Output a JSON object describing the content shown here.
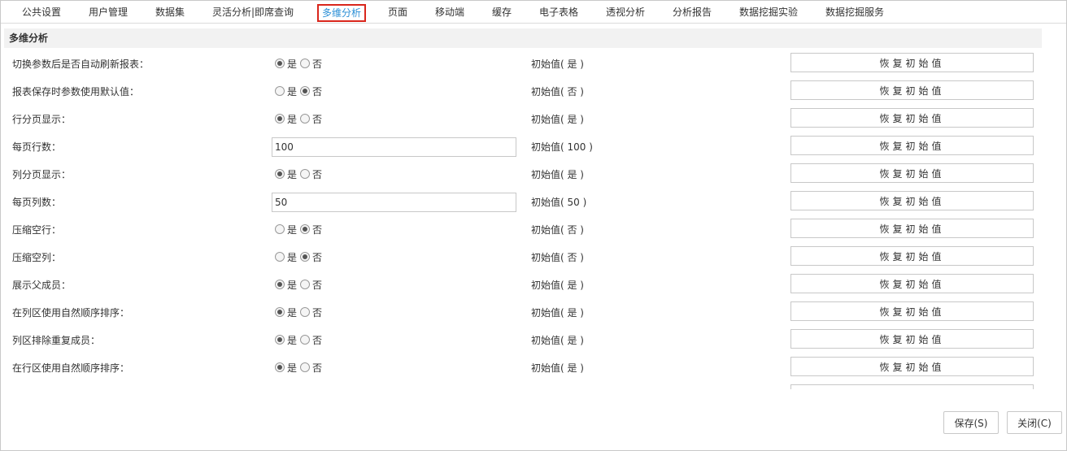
{
  "tabs": [
    {
      "label": "公共设置"
    },
    {
      "label": "用户管理"
    },
    {
      "label": "数据集"
    },
    {
      "label": "灵活分析|即席查询"
    },
    {
      "label": "多维分析",
      "active": true
    },
    {
      "label": "页面"
    },
    {
      "label": "移动端"
    },
    {
      "label": "缓存"
    },
    {
      "label": "电子表格"
    },
    {
      "label": "透视分析"
    },
    {
      "label": "分析报告"
    },
    {
      "label": "数据挖掘实验"
    },
    {
      "label": "数据挖掘服务"
    }
  ],
  "section_title": "多维分析",
  "radio_labels": {
    "yes": "是",
    "no": "否"
  },
  "reset_label": "恢复初始值",
  "rows": [
    {
      "label": "切换参数后是否自动刷新报表：",
      "type": "radio",
      "value": "yes",
      "initial": "初始值( 是 )"
    },
    {
      "label": "报表保存时参数使用默认值：",
      "type": "radio",
      "value": "no",
      "initial": "初始值( 否 )"
    },
    {
      "label": "行分页显示：",
      "type": "radio",
      "value": "yes",
      "initial": "初始值( 是 )"
    },
    {
      "label": "每页行数：",
      "type": "input",
      "value": "100",
      "initial": "初始值( 100 )"
    },
    {
      "label": "列分页显示：",
      "type": "radio",
      "value": "yes",
      "initial": "初始值( 是 )"
    },
    {
      "label": "每页列数：",
      "type": "input",
      "value": "50",
      "initial": "初始值( 50 )"
    },
    {
      "label": "压缩空行：",
      "type": "radio",
      "value": "no",
      "initial": "初始值( 否 )"
    },
    {
      "label": "压缩空列：",
      "type": "radio",
      "value": "no",
      "initial": "初始值( 否 )"
    },
    {
      "label": "展示父成员：",
      "type": "radio",
      "value": "yes",
      "initial": "初始值( 是 )"
    },
    {
      "label": "在列区使用自然顺序排序：",
      "type": "radio",
      "value": "yes",
      "initial": "初始值( 是 )"
    },
    {
      "label": "列区排除重复成员：",
      "type": "radio",
      "value": "yes",
      "initial": "初始值( 是 )"
    },
    {
      "label": "在行区使用自然顺序排序：",
      "type": "radio",
      "value": "yes",
      "initial": "初始值( 是 )"
    }
  ],
  "footer": {
    "save_label": "保存(S)",
    "close_label": "关闭(C)"
  }
}
